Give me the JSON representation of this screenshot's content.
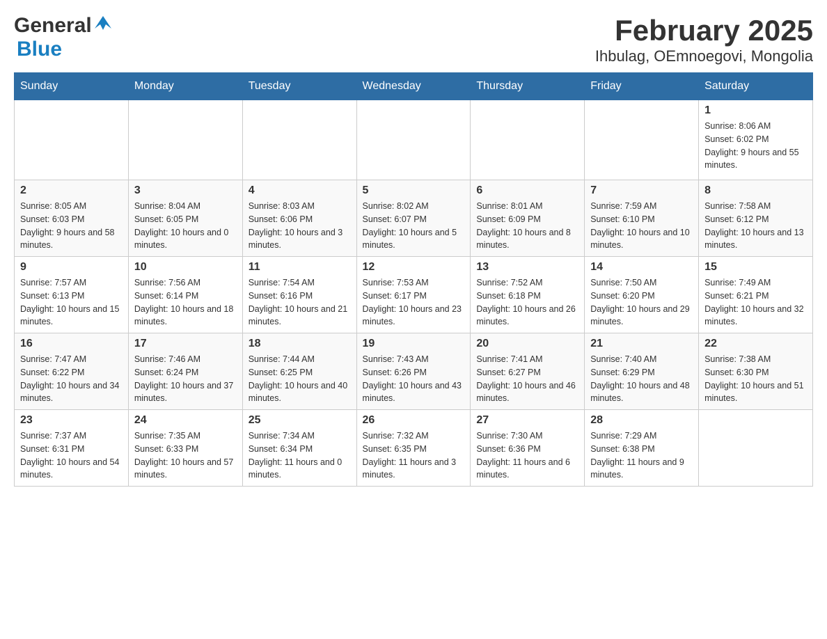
{
  "header": {
    "logo_general": "General",
    "logo_blue": "Blue",
    "title": "February 2025",
    "subtitle": "Ihbulag, OEmnoegovi, Mongolia"
  },
  "weekdays": [
    "Sunday",
    "Monday",
    "Tuesday",
    "Wednesday",
    "Thursday",
    "Friday",
    "Saturday"
  ],
  "weeks": [
    [
      {
        "day": "",
        "info": ""
      },
      {
        "day": "",
        "info": ""
      },
      {
        "day": "",
        "info": ""
      },
      {
        "day": "",
        "info": ""
      },
      {
        "day": "",
        "info": ""
      },
      {
        "day": "",
        "info": ""
      },
      {
        "day": "1",
        "info": "Sunrise: 8:06 AM\nSunset: 6:02 PM\nDaylight: 9 hours and 55 minutes."
      }
    ],
    [
      {
        "day": "2",
        "info": "Sunrise: 8:05 AM\nSunset: 6:03 PM\nDaylight: 9 hours and 58 minutes."
      },
      {
        "day": "3",
        "info": "Sunrise: 8:04 AM\nSunset: 6:05 PM\nDaylight: 10 hours and 0 minutes."
      },
      {
        "day": "4",
        "info": "Sunrise: 8:03 AM\nSunset: 6:06 PM\nDaylight: 10 hours and 3 minutes."
      },
      {
        "day": "5",
        "info": "Sunrise: 8:02 AM\nSunset: 6:07 PM\nDaylight: 10 hours and 5 minutes."
      },
      {
        "day": "6",
        "info": "Sunrise: 8:01 AM\nSunset: 6:09 PM\nDaylight: 10 hours and 8 minutes."
      },
      {
        "day": "7",
        "info": "Sunrise: 7:59 AM\nSunset: 6:10 PM\nDaylight: 10 hours and 10 minutes."
      },
      {
        "day": "8",
        "info": "Sunrise: 7:58 AM\nSunset: 6:12 PM\nDaylight: 10 hours and 13 minutes."
      }
    ],
    [
      {
        "day": "9",
        "info": "Sunrise: 7:57 AM\nSunset: 6:13 PM\nDaylight: 10 hours and 15 minutes."
      },
      {
        "day": "10",
        "info": "Sunrise: 7:56 AM\nSunset: 6:14 PM\nDaylight: 10 hours and 18 minutes."
      },
      {
        "day": "11",
        "info": "Sunrise: 7:54 AM\nSunset: 6:16 PM\nDaylight: 10 hours and 21 minutes."
      },
      {
        "day": "12",
        "info": "Sunrise: 7:53 AM\nSunset: 6:17 PM\nDaylight: 10 hours and 23 minutes."
      },
      {
        "day": "13",
        "info": "Sunrise: 7:52 AM\nSunset: 6:18 PM\nDaylight: 10 hours and 26 minutes."
      },
      {
        "day": "14",
        "info": "Sunrise: 7:50 AM\nSunset: 6:20 PM\nDaylight: 10 hours and 29 minutes."
      },
      {
        "day": "15",
        "info": "Sunrise: 7:49 AM\nSunset: 6:21 PM\nDaylight: 10 hours and 32 minutes."
      }
    ],
    [
      {
        "day": "16",
        "info": "Sunrise: 7:47 AM\nSunset: 6:22 PM\nDaylight: 10 hours and 34 minutes."
      },
      {
        "day": "17",
        "info": "Sunrise: 7:46 AM\nSunset: 6:24 PM\nDaylight: 10 hours and 37 minutes."
      },
      {
        "day": "18",
        "info": "Sunrise: 7:44 AM\nSunset: 6:25 PM\nDaylight: 10 hours and 40 minutes."
      },
      {
        "day": "19",
        "info": "Sunrise: 7:43 AM\nSunset: 6:26 PM\nDaylight: 10 hours and 43 minutes."
      },
      {
        "day": "20",
        "info": "Sunrise: 7:41 AM\nSunset: 6:27 PM\nDaylight: 10 hours and 46 minutes."
      },
      {
        "day": "21",
        "info": "Sunrise: 7:40 AM\nSunset: 6:29 PM\nDaylight: 10 hours and 48 minutes."
      },
      {
        "day": "22",
        "info": "Sunrise: 7:38 AM\nSunset: 6:30 PM\nDaylight: 10 hours and 51 minutes."
      }
    ],
    [
      {
        "day": "23",
        "info": "Sunrise: 7:37 AM\nSunset: 6:31 PM\nDaylight: 10 hours and 54 minutes."
      },
      {
        "day": "24",
        "info": "Sunrise: 7:35 AM\nSunset: 6:33 PM\nDaylight: 10 hours and 57 minutes."
      },
      {
        "day": "25",
        "info": "Sunrise: 7:34 AM\nSunset: 6:34 PM\nDaylight: 11 hours and 0 minutes."
      },
      {
        "day": "26",
        "info": "Sunrise: 7:32 AM\nSunset: 6:35 PM\nDaylight: 11 hours and 3 minutes."
      },
      {
        "day": "27",
        "info": "Sunrise: 7:30 AM\nSunset: 6:36 PM\nDaylight: 11 hours and 6 minutes."
      },
      {
        "day": "28",
        "info": "Sunrise: 7:29 AM\nSunset: 6:38 PM\nDaylight: 11 hours and 9 minutes."
      },
      {
        "day": "",
        "info": ""
      }
    ]
  ]
}
